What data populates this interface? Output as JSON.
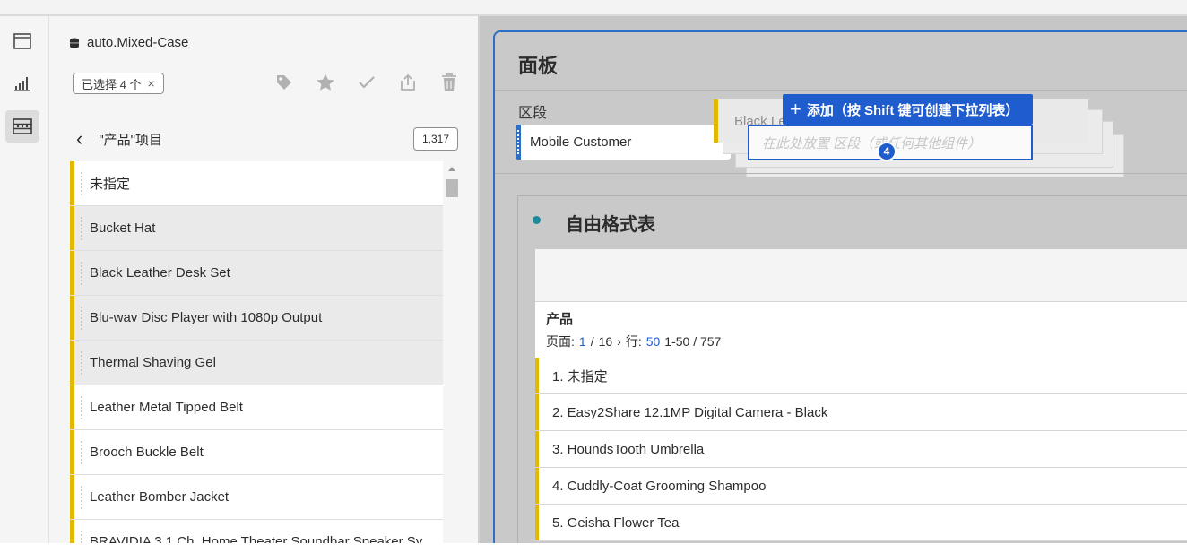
{
  "left_panel": {
    "datasource": "auto.Mixed-Case",
    "selected_chip": "已选择 4 个",
    "chip_close": "×",
    "back": "‹",
    "list_title": "\"产品\"项目",
    "count": "1,317",
    "items": [
      {
        "label": "未指定",
        "selected": false
      },
      {
        "label": "Bucket Hat",
        "selected": true
      },
      {
        "label": "Black Leather Desk Set",
        "selected": true
      },
      {
        "label": "Blu-wav Disc Player with 1080p Output",
        "selected": true
      },
      {
        "label": "Thermal Shaving Gel",
        "selected": true
      },
      {
        "label": "Leather Metal Tipped Belt",
        "selected": false
      },
      {
        "label": "Brooch Buckle Belt",
        "selected": false
      },
      {
        "label": "Leather Bomber Jacket",
        "selected": false
      },
      {
        "label": "BRAVIDIA 3.1 Ch. Home Theater Soundbar Speaker Sy...",
        "selected": false
      }
    ]
  },
  "canvas": {
    "title": "面板",
    "segment_label": "区段",
    "segment_chip": "Mobile Customer",
    "drag_ghost_text": "Black Le",
    "tooltip_plus": "+",
    "tooltip": "添加（按 Shift 键可创建下拉列表）",
    "drop_placeholder": "在此处放置 区段（或任何其他组件）",
    "drag_count": "4"
  },
  "table": {
    "viz_title": "自由格式表",
    "column_title": "产品",
    "pager": {
      "page_label": "页面:",
      "page": "1",
      "sep": "/",
      "total_pages": "16",
      "arrow": "›",
      "rows_label": "行:",
      "rows": "50",
      "range": "1-50 / 757"
    },
    "rows": [
      "1. 未指定",
      "2. Easy2Share 12.1MP Digital Camera - Black",
      "3. HoundsTooth Umbrella",
      "4. Cuddly-Coat Grooming Shampoo",
      "5. Geisha Flower Tea"
    ]
  },
  "icons": {
    "rail": [
      "panel-icon",
      "visualization-icon",
      "components-icon"
    ],
    "toolbar": [
      "tag-icon",
      "star-icon",
      "check-icon",
      "share-icon",
      "trash-icon"
    ]
  },
  "colors": {
    "accent": "#1f5ccd",
    "item_bar": "#e0b900",
    "viz_dot": "#1c8a9a"
  }
}
